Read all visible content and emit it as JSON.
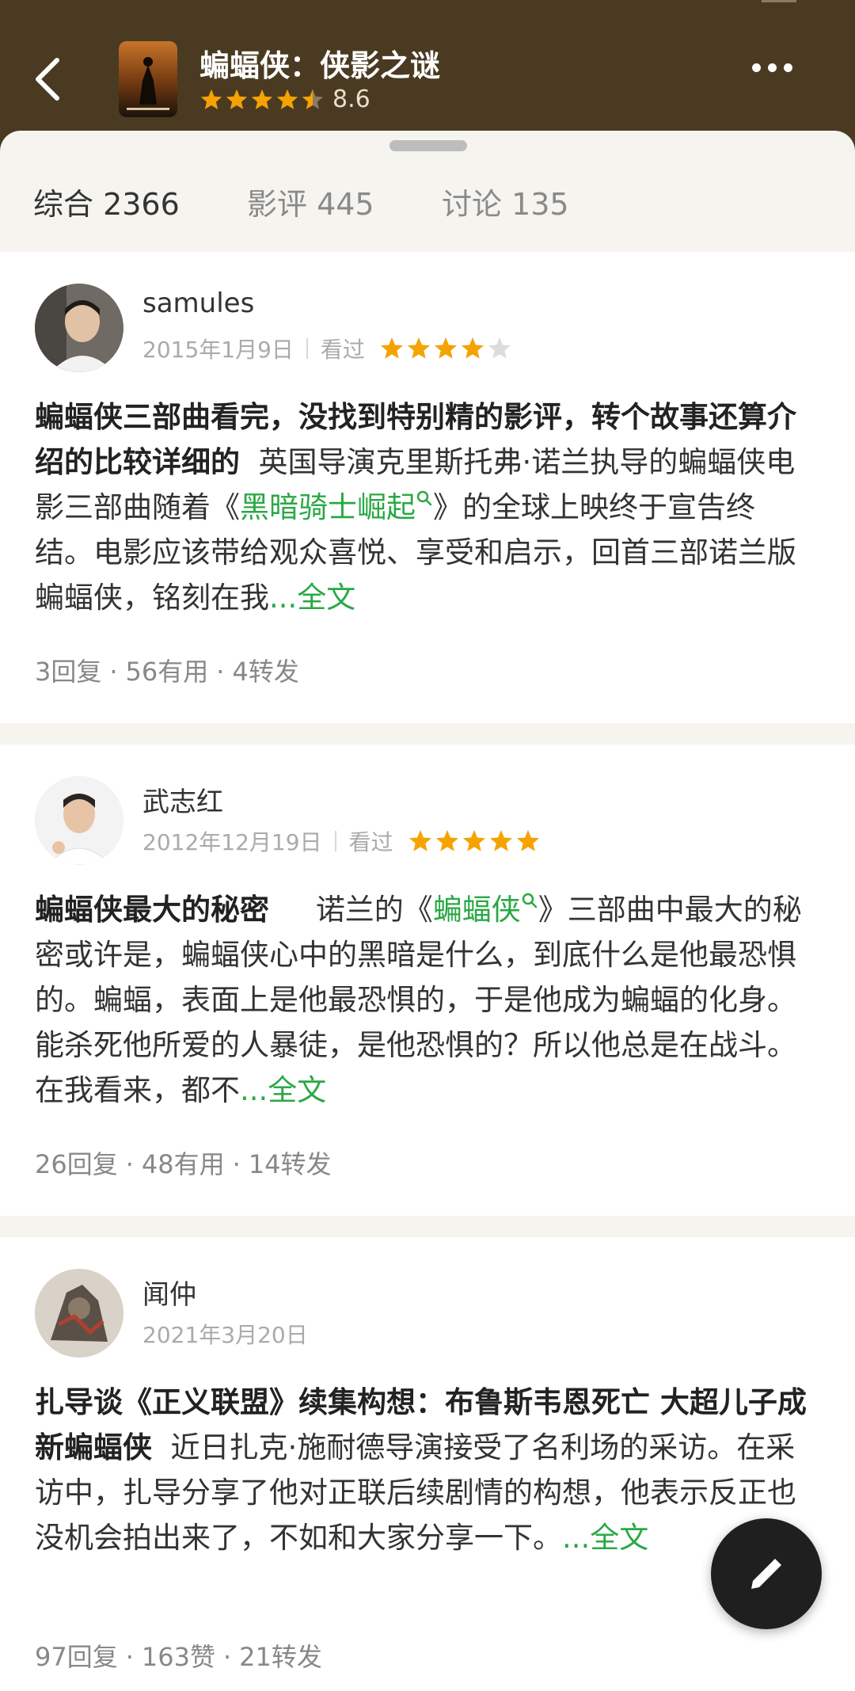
{
  "header": {
    "title": "蝙蝠侠：侠影之谜",
    "rating": "8.6",
    "rating_stars": 4.5
  },
  "tabs": [
    {
      "label": "综合 2366"
    },
    {
      "label": "影评 445"
    },
    {
      "label": "讨论 135"
    }
  ],
  "reviews": [
    {
      "user": "samules",
      "date": "2015年1月9日",
      "status": "看过",
      "stars": 4,
      "title": "蝙蝠侠三部曲看完，没找到特别精的影评，转个故事还算介绍的比较详细的",
      "text_before": "英国导演克里斯托弗·诺兰执导的蝙蝠侠电影三部曲随着《",
      "link": "黑暗骑士崛起",
      "text_after": "》的全球上映终于宣告终结。电影应该带给观众喜悦、享受和启示，回首三部诺兰版蝙蝠侠，铭刻在我",
      "more": "...全文",
      "replies": "3回复",
      "useful": "56有用",
      "shares": "4转发"
    },
    {
      "user": "武志红",
      "date": "2012年12月19日",
      "status": "看过",
      "stars": 5,
      "title": "蝙蝠侠最大的秘密",
      "text_before": "诺兰的《",
      "link": "蝙蝠侠",
      "text_after": "》三部曲中最大的秘密或许是，蝙蝠侠心中的黑暗是什么，到底什么是他最恐惧的。蝙蝠，表面上是他最恐惧的，于是他成为蝙蝠的化身。能杀死他所爱的人暴徒，是他恐惧的？所以他总是在战斗。在我看来，都不",
      "more": "...全文",
      "replies": "26回复",
      "useful": "48有用",
      "shares": "14转发"
    },
    {
      "user": "闻仲",
      "date": "2021年3月20日",
      "title": "扎导谈《正义联盟》续集构想：布鲁斯韦恩死亡 大超儿子成新蝙蝠侠",
      "text": "近日扎克·施耐德导演接受了名利场的采访。在采访中，扎导分享了他对正联后续剧情的构想，他表示反正也没机会拍出来了，不如和大家分享一下。",
      "more": "...全文",
      "replies": "97回复",
      "likes": "163赞",
      "shares": "21转发"
    }
  ],
  "colors": {
    "header_bg": "#4a3a22",
    "accent_green": "#2aa845",
    "star": "#f5a300"
  }
}
